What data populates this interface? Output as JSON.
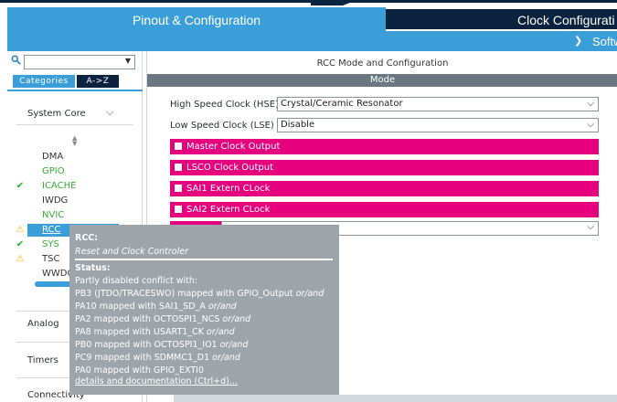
{
  "tabs": {
    "pinout": "Pinout & Configuration",
    "clock": "Clock Configurati",
    "software": "Softw"
  },
  "left": {
    "search": {
      "value": "",
      "placeholder": ""
    },
    "category_tabs": [
      "Categories",
      "A->Z"
    ],
    "groups": {
      "system_core": "System Core",
      "analog": "Analog",
      "timers": "Timers",
      "connectivity": "Connectivity"
    },
    "peripherals": [
      {
        "name": "DMA",
        "status": "none",
        "color": "dark"
      },
      {
        "name": "GPIO",
        "status": "none",
        "color": "green"
      },
      {
        "name": "ICACHE",
        "status": "ok",
        "color": "green"
      },
      {
        "name": "IWDG",
        "status": "none",
        "color": "dark"
      },
      {
        "name": "NVIC",
        "status": "none",
        "color": "green"
      },
      {
        "name": "RCC",
        "status": "warn",
        "color": "selected"
      },
      {
        "name": "SYS",
        "status": "ok",
        "color": "green"
      },
      {
        "name": "TSC",
        "status": "warn",
        "color": "dark"
      },
      {
        "name": "WWDG",
        "status": "none",
        "color": "dark"
      }
    ]
  },
  "right": {
    "title": "RCC Mode and Configuration",
    "mode_header": "Mode",
    "hse": {
      "label": "High Speed Clock (HSE)",
      "value": "Crystal/Ceramic Resonator"
    },
    "lse": {
      "label": "Low Speed Clock (LSE)",
      "value": "Disable"
    },
    "options": [
      "Master Clock Output",
      "LSCO Clock Output",
      "SAI1 Extern CLock",
      "SAI2 Extern CLock"
    ]
  },
  "tooltip": {
    "title": "RCC",
    "title_suffix": ":",
    "subtitle": "Reset and Clock Controler",
    "status_label": "Status:",
    "conflict_intro": "Partly disabled conflict with:",
    "conflicts": [
      {
        "text": "PB3 (JTDO/TRACESWO) mapped with GPIO_Output",
        "suffix": "or/and"
      },
      {
        "text": "PA10 mapped with SAI1_SD_A",
        "suffix": "or/and"
      },
      {
        "text": "PA2 mapped with OCTOSPI1_NCS",
        "suffix": "or/and"
      },
      {
        "text": "PA8 mapped with USART1_CK",
        "suffix": "or/and"
      },
      {
        "text": "PB0 mapped with OCTOSPI1_IO1",
        "suffix": "or/and"
      },
      {
        "text": "PC9 mapped with SDMMC1_D1",
        "suffix": "or/and"
      },
      {
        "text": "PA0 mapped with GPIO_EXTI0",
        "suffix": ""
      }
    ],
    "link": "details and documentation (Ctrl+d)..."
  },
  "colors": {
    "accent": "#3a9fd8",
    "navy": "#0b2240",
    "magenta": "#e6007e",
    "tooltip_bg": "#9da5ab"
  }
}
